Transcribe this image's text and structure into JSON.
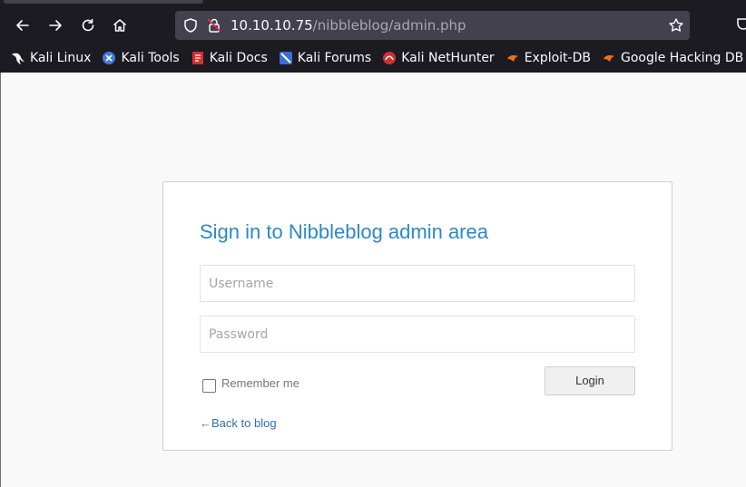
{
  "browser": {
    "url_host": "10.10.10.75",
    "url_path": "/nibbleblog/admin.php",
    "bookmarks": [
      {
        "label": "Kali Linux",
        "icon": "kali-dragon-icon",
        "color": "#ffffff"
      },
      {
        "label": "Kali Tools",
        "icon": "kali-tools-icon",
        "color": "#3b7ddd"
      },
      {
        "label": "Kali Docs",
        "icon": "kali-docs-icon",
        "color": "#d32f2f"
      },
      {
        "label": "Kali Forums",
        "icon": "kali-forums-icon",
        "color": "#3b6fd8"
      },
      {
        "label": "Kali NetHunter",
        "icon": "nethunter-icon",
        "color": "#d32f2f"
      },
      {
        "label": "Exploit-DB",
        "icon": "exploit-db-icon",
        "color": "#e8731a"
      },
      {
        "label": "Google Hacking DB",
        "icon": "ghdb-icon",
        "color": "#e8731a"
      }
    ]
  },
  "login": {
    "title": "Sign in to Nibbleblog admin area",
    "username_placeholder": "Username",
    "password_placeholder": "Password",
    "remember_label": "Remember me",
    "login_button": "Login",
    "back_link": "←Back to blog"
  },
  "colors": {
    "title": "#2d88c8",
    "link": "#2d6fb5",
    "chrome_bg": "#1c1b22",
    "urlbar_bg": "#42414d"
  }
}
